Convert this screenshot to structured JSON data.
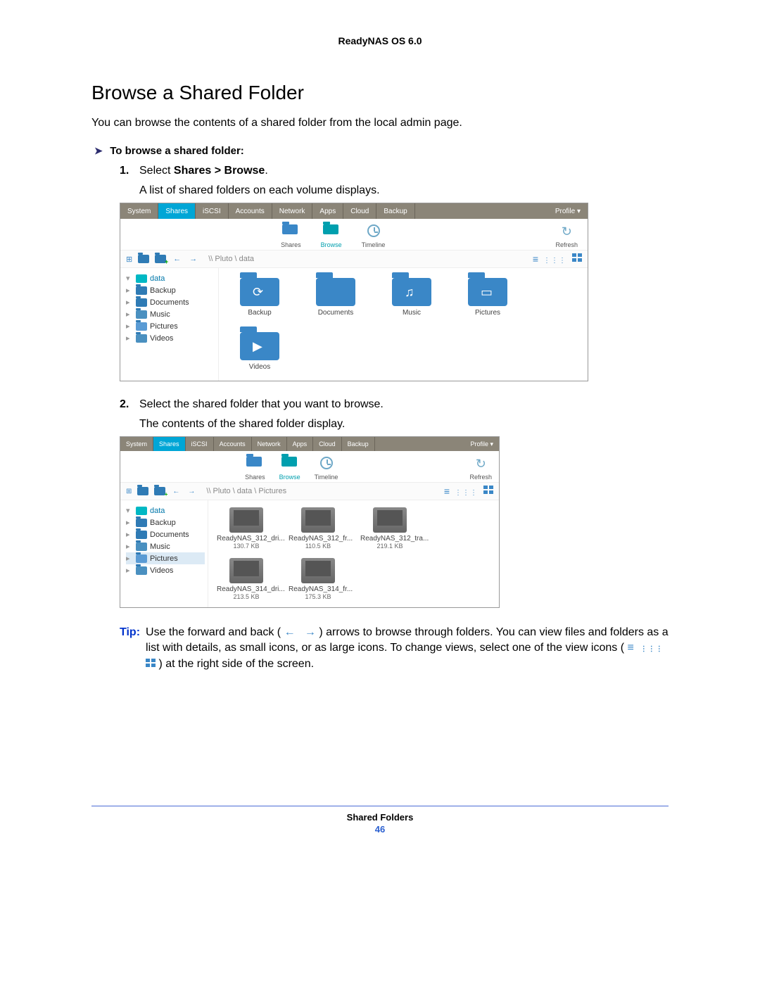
{
  "header": {
    "product": "ReadyNAS OS 6.0"
  },
  "title": "Browse a Shared Folder",
  "intro": "You can browse the contents of a shared folder from the local admin page.",
  "procedure_head": "To browse a shared folder:",
  "steps": {
    "s1": {
      "num": "1.",
      "prefix": "Select ",
      "bold": "Shares > Browse",
      "suffix": "."
    },
    "s1_sub": "A list of shared folders on each volume displays.",
    "s2": {
      "num": "2.",
      "text": "Select the shared folder that you want to browse."
    },
    "s2_sub": "The contents of the shared folder display."
  },
  "nav_tabs": [
    "System",
    "Shares",
    "iSCSI",
    "Accounts",
    "Network",
    "Apps",
    "Cloud",
    "Backup"
  ],
  "nav_profile": "Profile ▾",
  "subtabs": {
    "shares": "Shares",
    "browse": "Browse",
    "timeline": "Timeline",
    "refresh": "Refresh"
  },
  "shot1": {
    "path": "\\\\ Pluto \\ data",
    "tree_root": "data",
    "tree": [
      "Backup",
      "Documents",
      "Music",
      "Pictures",
      "Videos"
    ],
    "folders": [
      "Backup",
      "Documents",
      "Music",
      "Pictures",
      "Videos"
    ]
  },
  "shot2": {
    "path": "\\\\ Pluto \\ data \\ Pictures",
    "tree_root": "data",
    "tree": [
      "Backup",
      "Documents",
      "Music",
      "Pictures",
      "Videos"
    ],
    "files": [
      {
        "name": "ReadyNAS_312_dri...",
        "size": "130.7 KB"
      },
      {
        "name": "ReadyNAS_312_fr...",
        "size": "110.5 KB"
      },
      {
        "name": "ReadyNAS_312_tra...",
        "size": "219.1 KB"
      },
      {
        "name": "ReadyNAS_314_dri...",
        "size": "213.5 KB"
      },
      {
        "name": "ReadyNAS_314_fr...",
        "size": "175.3 KB"
      }
    ]
  },
  "tip": {
    "label": "Tip:",
    "l1a": "Use the forward and back (",
    "l1b": ") arrows to browse through folders. You can view files and folders as a list with details, as small icons, or as large icons. To change views, select one of the view icons (",
    "l1c": ") at the right side of the screen."
  },
  "footer": {
    "section": "Shared Folders",
    "page": "46"
  }
}
